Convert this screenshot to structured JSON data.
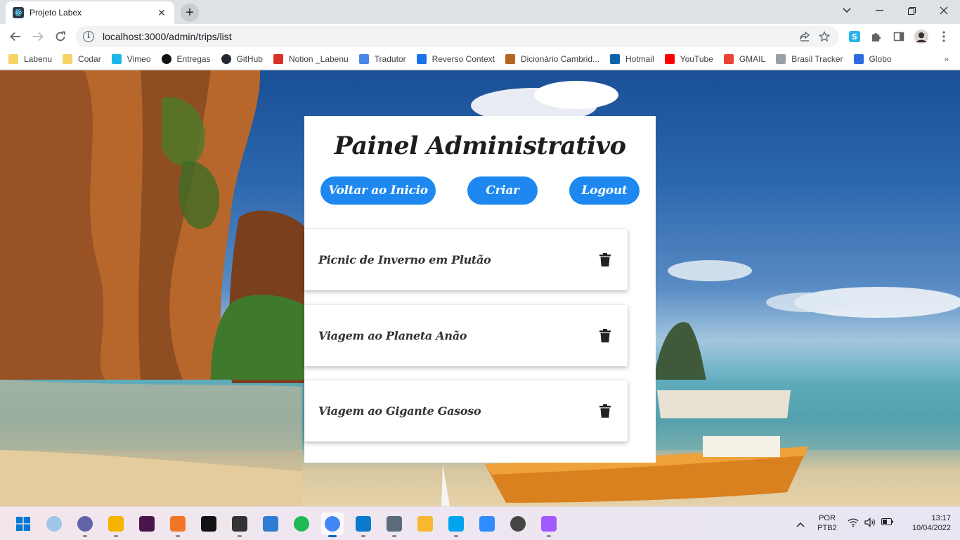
{
  "browser": {
    "tab_title": "Projeto Labex",
    "new_tab_label": "+",
    "url": "localhost:3000/admin/trips/list"
  },
  "bookmarks": [
    {
      "label": "Labenu",
      "icon": "folder-icon",
      "color": "#f6d365"
    },
    {
      "label": "Codar",
      "icon": "folder-icon",
      "color": "#f6d365"
    },
    {
      "label": "Vimeo",
      "icon": "vimeo-icon",
      "color": "#1ab7ea"
    },
    {
      "label": "Entregas",
      "icon": "circle-icon",
      "color": "#111111"
    },
    {
      "label": "GitHub",
      "icon": "github-icon",
      "color": "#24292f"
    },
    {
      "label": "Notion _Labenu",
      "icon": "apple-icon",
      "color": "#d93025"
    },
    {
      "label": "Tradutor",
      "icon": "translate-icon",
      "color": "#4a86e8"
    },
    {
      "label": "Reverso Context",
      "icon": "reverso-icon",
      "color": "#1a73e8"
    },
    {
      "label": "Dicionário Cambrid...",
      "icon": "shield-icon",
      "color": "#b5651d"
    },
    {
      "label": "Hotmail",
      "icon": "outlook-icon",
      "color": "#0a64ad"
    },
    {
      "label": "YouTube",
      "icon": "youtube-icon",
      "color": "#ff0000"
    },
    {
      "label": "GMAIL",
      "icon": "gmail-icon",
      "color": "#ea4335"
    },
    {
      "label": "Brasil Tracker",
      "icon": "lock-icon",
      "color": "#9aa0a6"
    },
    {
      "label": "Globo",
      "icon": "globo-icon",
      "color": "#2d6cdf"
    }
  ],
  "bookmarks_more": "»",
  "page": {
    "title": "Painel Administrativo",
    "buttons": {
      "home": "Voltar ao Inicio",
      "create": "Criar",
      "logout": "Logout"
    },
    "trips": [
      {
        "name": "Picnic de Inverno em Plutão"
      },
      {
        "name": "Viagem ao Planeta Anão"
      },
      {
        "name": "Viagem ao Gigante Gasoso"
      }
    ]
  },
  "taskbar": {
    "apps": [
      {
        "name": "start-icon",
        "color": "#0078d4"
      },
      {
        "name": "weather-icon",
        "color": "#9fc5e8"
      },
      {
        "name": "teams-chat-icon",
        "color": "#6264a7"
      },
      {
        "name": "file-explorer-icon",
        "color": "#f4b400"
      },
      {
        "name": "slack-icon",
        "color": "#4a154b"
      },
      {
        "name": "jupyter-icon",
        "color": "#f37626"
      },
      {
        "name": "pycharm-icon",
        "color": "#111111"
      },
      {
        "name": "bookmark-app-icon",
        "color": "#333333"
      },
      {
        "name": "notepad-icon",
        "color": "#2d7dd2"
      },
      {
        "name": "spotify-icon",
        "color": "#1db954"
      },
      {
        "name": "chrome-icon",
        "color": "#4285f4"
      },
      {
        "name": "vscode-icon",
        "color": "#0a7acc"
      },
      {
        "name": "photos-app-icon",
        "color": "#5a6b7b"
      },
      {
        "name": "media-player-icon",
        "color": "#f7b731"
      },
      {
        "name": "maps-app-icon",
        "color": "#00a4ef"
      },
      {
        "name": "zoom-icon",
        "color": "#2d8cff"
      },
      {
        "name": "clock-app-icon",
        "color": "#444444"
      },
      {
        "name": "figma-icon",
        "color": "#a259ff"
      }
    ],
    "language": "POR",
    "keyboard": "PTB2",
    "time": "13:17",
    "date": "10/04/2022"
  }
}
